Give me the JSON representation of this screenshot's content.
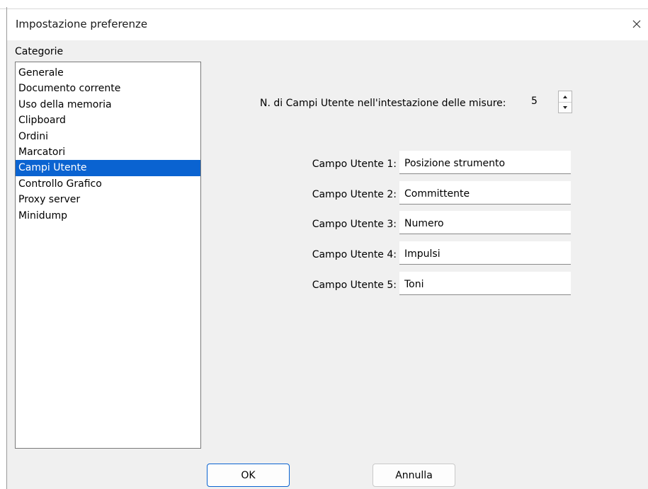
{
  "dialog": {
    "title": "Impostazione preferenze",
    "close_icon": "close-icon"
  },
  "categories": {
    "label": "Categorie",
    "items": [
      {
        "label": "Generale",
        "selected": false
      },
      {
        "label": "Documento corrente",
        "selected": false
      },
      {
        "label": "Uso della memoria",
        "selected": false
      },
      {
        "label": "Clipboard",
        "selected": false
      },
      {
        "label": "Ordini",
        "selected": false
      },
      {
        "label": "Marcatori",
        "selected": false
      },
      {
        "label": "Campi Utente",
        "selected": true
      },
      {
        "label": "Controllo Grafico",
        "selected": false
      },
      {
        "label": "Proxy server",
        "selected": false
      },
      {
        "label": "Minidump",
        "selected": false
      }
    ]
  },
  "user_fields": {
    "count_label": "N. di Campi Utente nell'intestazione delle misure:",
    "count_value": "5",
    "fields": [
      {
        "label": "Campo Utente 1:",
        "value": "Posizione strumento"
      },
      {
        "label": "Campo Utente 2:",
        "value": "Committente"
      },
      {
        "label": "Campo Utente 3:",
        "value": "Numero"
      },
      {
        "label": "Campo Utente 4:",
        "value": "Impulsi"
      },
      {
        "label": "Campo Utente 5:",
        "value": "Toni"
      }
    ]
  },
  "buttons": {
    "ok_label": "OK",
    "cancel_label": "Annulla"
  },
  "colors": {
    "selection": "#0a63d1",
    "dialog_bg": "#f0f0f0"
  }
}
